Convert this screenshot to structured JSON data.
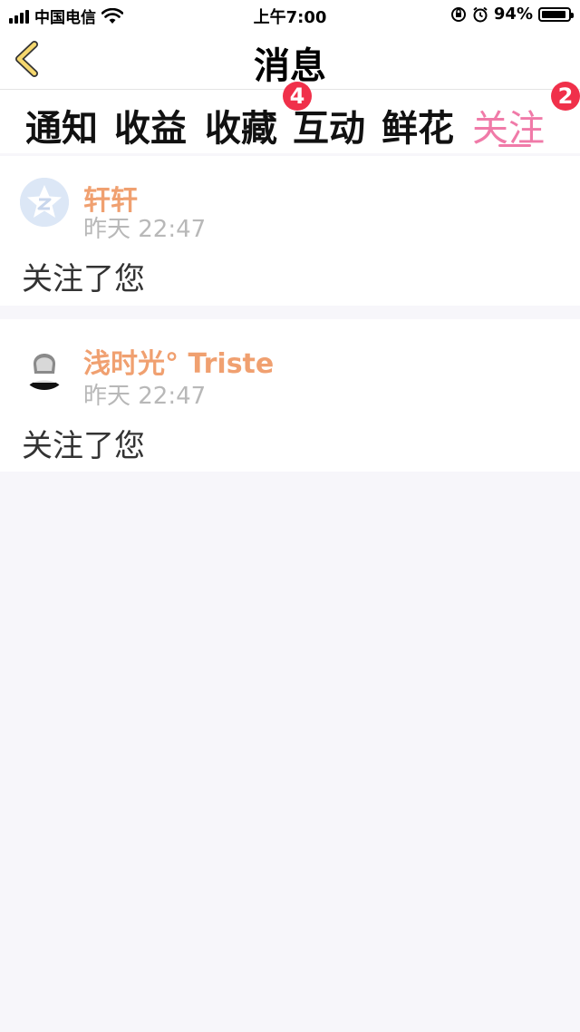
{
  "status_bar": {
    "carrier": "中国电信",
    "time": "上午7:00",
    "battery_percent": "94%",
    "battery_level": 0.94,
    "icons": [
      "signal-icon",
      "wifi-icon",
      "orientation-lock-icon",
      "alarm-icon",
      "battery-icon"
    ]
  },
  "nav": {
    "title": "消息",
    "back_icon": "chevron-left-icon",
    "back_color": "#f5d76e"
  },
  "tabs": [
    {
      "label": "通知",
      "active": false
    },
    {
      "label": "收益",
      "active": false
    },
    {
      "label": "收藏",
      "active": false,
      "badge": "4"
    },
    {
      "label": "互动",
      "active": false
    },
    {
      "label": "鲜花",
      "active": false
    },
    {
      "label": "关注",
      "active": true,
      "badge": "2"
    }
  ],
  "messages": [
    {
      "name": "轩轩",
      "time": "昨天 22:47",
      "text": "关注了您",
      "avatar_icon": "qzone-default-avatar-icon"
    },
    {
      "name": "浅时光° Triste",
      "time": "昨天 22:47",
      "text": "关注了您",
      "avatar_icon": "user-photo-avatar"
    }
  ],
  "colors": {
    "accent_pink": "#f07aa8",
    "name_orange": "#f0a070",
    "badge_red": "#f0304a",
    "timestamp_gray": "#b8b8b8",
    "page_bg": "#f7f6fa"
  }
}
